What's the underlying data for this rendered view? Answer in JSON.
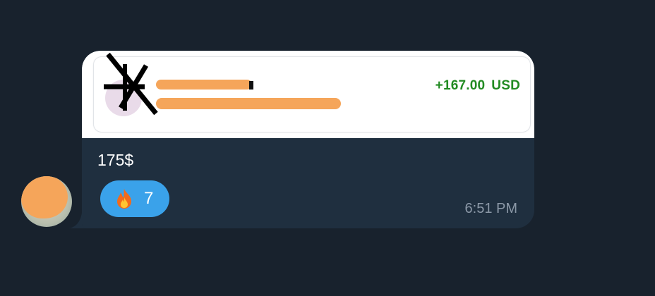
{
  "message": {
    "text": "175$",
    "time": "6:51 PM",
    "reaction": {
      "emoji": "fire-icon",
      "count": "7"
    }
  },
  "payment_card": {
    "amount": "+167.00",
    "currency": "USD",
    "amount_color": "#228b22"
  },
  "colors": {
    "background": "#18222d",
    "bubble": "#1f2f3f",
    "reaction_bg": "#3aa2ea",
    "redaction": "#f5a55a"
  }
}
